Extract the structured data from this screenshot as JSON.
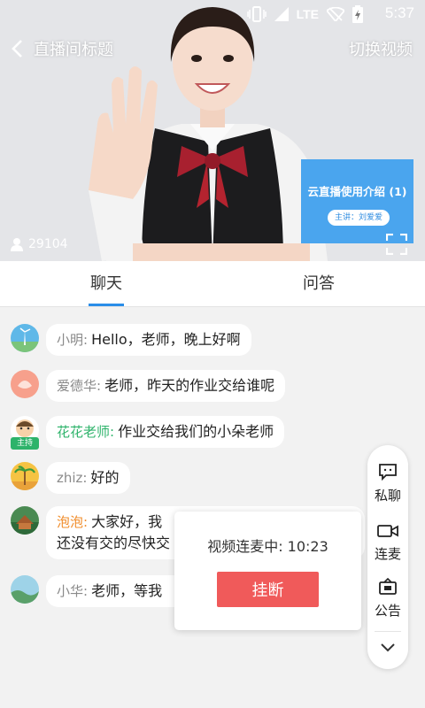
{
  "status_bar": {
    "time": "5:37",
    "network": "LTE"
  },
  "video": {
    "title": "直播间标题",
    "switch_label": "切换视频",
    "viewer_count": "29104",
    "ppt": {
      "title": "云直播使用介绍 (1)",
      "speaker": "主讲：刘爱爱"
    }
  },
  "tabs": [
    {
      "label": "聊天",
      "active": true
    },
    {
      "label": "问答",
      "active": false
    }
  ],
  "messages": [
    {
      "name": "小明:",
      "text": "Hello，老师，晚上好啊"
    },
    {
      "name": "爱德华:",
      "text": "老师，昨天的作业交给谁呢"
    },
    {
      "name": "花花老师:",
      "text": "作业交给我们的小朵老师",
      "badge": "主持"
    },
    {
      "name": "zhiz:",
      "text": "好的"
    },
    {
      "name": "泡泡:",
      "text": "大家好，我",
      "text2": "还没有交的尽快交"
    },
    {
      "name": "小华:",
      "text": "老师，等我"
    }
  ],
  "side_menu": [
    {
      "label": "私聊",
      "icon": "private-chat-icon"
    },
    {
      "label": "连麦",
      "icon": "camera-icon"
    },
    {
      "label": "公告",
      "icon": "notice-icon"
    }
  ],
  "popup": {
    "text": "视频连麦中: 10:23",
    "hangup_label": "挂断"
  },
  "colors": {
    "accent": "#2a8de8",
    "host": "#2db36a",
    "hangup": "#f05a5a",
    "ppt": "#4aa5ee"
  }
}
